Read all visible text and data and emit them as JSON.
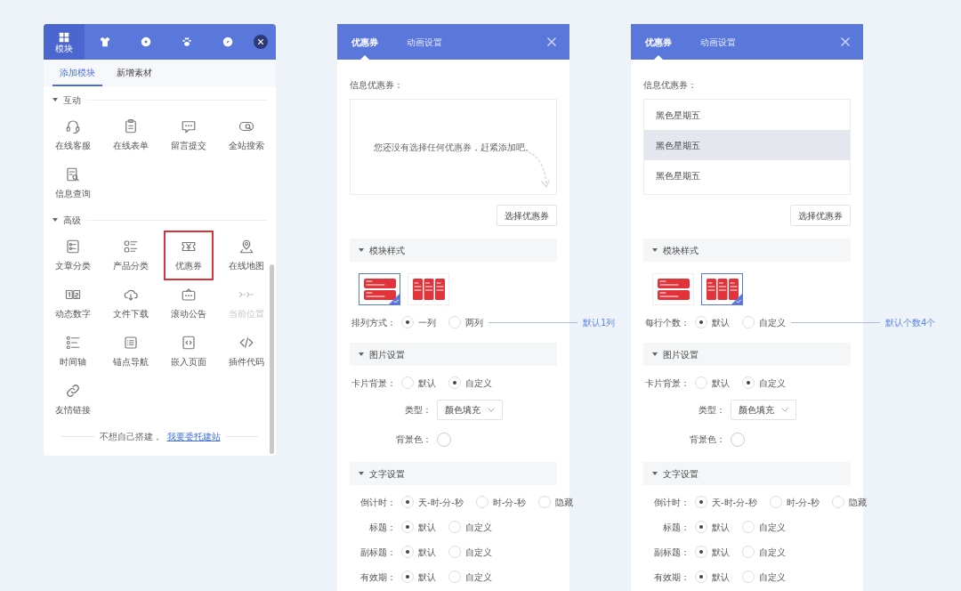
{
  "builder": {
    "nav": [
      {
        "label": "模块",
        "selected": true
      },
      {
        "selected": false
      },
      {
        "selected": false
      },
      {
        "selected": false
      },
      {
        "selected": false
      }
    ],
    "sub_tabs": [
      {
        "label": "添加模块",
        "selected": true
      },
      {
        "label": "新增素材",
        "selected": false
      }
    ],
    "sections": [
      {
        "title": "互动",
        "expanded": true,
        "items": [
          {
            "label": "在线客服",
            "highlighted": false,
            "disabled": false
          },
          {
            "label": "在线表单",
            "highlighted": false,
            "disabled": false
          },
          {
            "label": "留言提交",
            "highlighted": false,
            "disabled": false
          },
          {
            "label": "全站搜索",
            "highlighted": false,
            "disabled": false
          },
          {
            "label": "信息查询",
            "highlighted": false,
            "disabled": false
          }
        ]
      },
      {
        "title": "高级",
        "expanded": true,
        "items": [
          {
            "label": "文章分类",
            "highlighted": false,
            "disabled": false
          },
          {
            "label": "产品分类",
            "highlighted": false,
            "disabled": false
          },
          {
            "label": "优惠券",
            "highlighted": true,
            "disabled": false
          },
          {
            "label": "在线地图",
            "highlighted": false,
            "disabled": false
          },
          {
            "label": "动态数字",
            "highlighted": false,
            "disabled": false
          },
          {
            "label": "文件下载",
            "highlighted": false,
            "disabled": false
          },
          {
            "label": "滚动公告",
            "highlighted": false,
            "disabled": false
          },
          {
            "label": "当前位置",
            "highlighted": false,
            "disabled": true
          },
          {
            "label": "时间轴",
            "highlighted": false,
            "disabled": false
          },
          {
            "label": "锚点导航",
            "highlighted": false,
            "disabled": false
          },
          {
            "label": "嵌入页面",
            "highlighted": false,
            "disabled": false
          },
          {
            "label": "插件代码",
            "highlighted": false,
            "disabled": false
          },
          {
            "label": "友情链接",
            "highlighted": false,
            "disabled": false
          }
        ]
      }
    ],
    "footer": {
      "text": "不想自己搭建，",
      "link": "我要委托建站"
    }
  },
  "panels": [
    {
      "tabs": [
        {
          "label": "优惠券",
          "selected": true
        },
        {
          "label": "动画设置",
          "selected": false
        }
      ],
      "field_label": "信息优惠券：",
      "coupon_box": {
        "empty_message": "您还没有选择任何优惠券，赶紧添加吧。"
      },
      "select_button": "选择优惠券",
      "sections": [
        {
          "title": "模块样式",
          "expanded": true,
          "rows": [
            {
              "kind": "styles",
              "options": [
                {
                  "kind": "rows",
                  "selected": true
                },
                {
                  "kind": "columns",
                  "selected": false
                }
              ]
            },
            {
              "kind": "radio",
              "label": "排列方式：",
              "options": [
                {
                  "label": "一列",
                  "selected": true
                },
                {
                  "label": "两列",
                  "selected": false
                }
              ],
              "annotation": "默认1列"
            }
          ]
        },
        {
          "title": "图片设置",
          "expanded": true,
          "rows": [
            {
              "kind": "radio",
              "label": "卡片背景：",
              "options": [
                {
                  "label": "默认",
                  "selected": false
                },
                {
                  "label": "自定义",
                  "selected": true
                }
              ]
            },
            {
              "kind": "select",
              "label": "类型：",
              "value": "颜色填充"
            },
            {
              "kind": "color",
              "label": "背景色："
            }
          ]
        },
        {
          "title": "文字设置",
          "expanded": true,
          "rows": [
            {
              "kind": "radio",
              "label": "倒计时：",
              "options": [
                {
                  "label": "天-时-分-秒",
                  "selected": true
                },
                {
                  "label": "时-分-秒",
                  "selected": false
                },
                {
                  "label": "隐藏",
                  "selected": false
                }
              ]
            },
            {
              "kind": "radio",
              "label": "标题：",
              "options": [
                {
                  "label": "默认",
                  "selected": true
                },
                {
                  "label": "自定义",
                  "selected": false
                }
              ]
            },
            {
              "kind": "radio",
              "label": "副标题：",
              "options": [
                {
                  "label": "默认",
                  "selected": true
                },
                {
                  "label": "自定义",
                  "selected": false
                }
              ]
            },
            {
              "kind": "radio",
              "label": "有效期：",
              "options": [
                {
                  "label": "默认",
                  "selected": true
                },
                {
                  "label": "自定义",
                  "selected": false
                }
              ]
            }
          ]
        }
      ]
    },
    {
      "tabs": [
        {
          "label": "优惠券",
          "selected": true
        },
        {
          "label": "动画设置",
          "selected": false
        }
      ],
      "field_label": "信息优惠券：",
      "coupon_box": {
        "coupons": [
          {
            "name": "黑色星期五",
            "highlighted": false
          },
          {
            "name": "黑色星期五",
            "highlighted": true
          },
          {
            "name": "黑色星期五",
            "highlighted": false
          }
        ]
      },
      "select_button": "选择优惠券",
      "sections": [
        {
          "title": "模块样式",
          "expanded": true,
          "rows": [
            {
              "kind": "styles",
              "options": [
                {
                  "kind": "rows",
                  "selected": false
                },
                {
                  "kind": "columns",
                  "selected": true
                }
              ]
            },
            {
              "kind": "radio",
              "label": "每行个数：",
              "options": [
                {
                  "label": "默认",
                  "selected": true
                },
                {
                  "label": "自定义",
                  "selected": false
                }
              ],
              "annotation": "默认个数4个"
            }
          ]
        },
        {
          "title": "图片设置",
          "expanded": true,
          "rows": [
            {
              "kind": "radio",
              "label": "卡片背景：",
              "options": [
                {
                  "label": "默认",
                  "selected": false
                },
                {
                  "label": "自定义",
                  "selected": true
                }
              ]
            },
            {
              "kind": "select",
              "label": "类型：",
              "value": "颜色填充"
            },
            {
              "kind": "color",
              "label": "背景色："
            }
          ]
        },
        {
          "title": "文字设置",
          "expanded": true,
          "rows": [
            {
              "kind": "radio",
              "label": "倒计时：",
              "options": [
                {
                  "label": "天-时-分-秒",
                  "selected": true
                },
                {
                  "label": "时-分-秒",
                  "selected": false
                },
                {
                  "label": "隐藏",
                  "selected": false
                }
              ]
            },
            {
              "kind": "radio",
              "label": "标题：",
              "options": [
                {
                  "label": "默认",
                  "selected": true
                },
                {
                  "label": "自定义",
                  "selected": false
                }
              ]
            },
            {
              "kind": "radio",
              "label": "副标题：",
              "options": [
                {
                  "label": "默认",
                  "selected": true
                },
                {
                  "label": "自定义",
                  "selected": false
                }
              ]
            },
            {
              "kind": "radio",
              "label": "有效期：",
              "options": [
                {
                  "label": "默认",
                  "selected": true
                },
                {
                  "label": "自定义",
                  "selected": false
                }
              ]
            }
          ]
        }
      ]
    }
  ]
}
